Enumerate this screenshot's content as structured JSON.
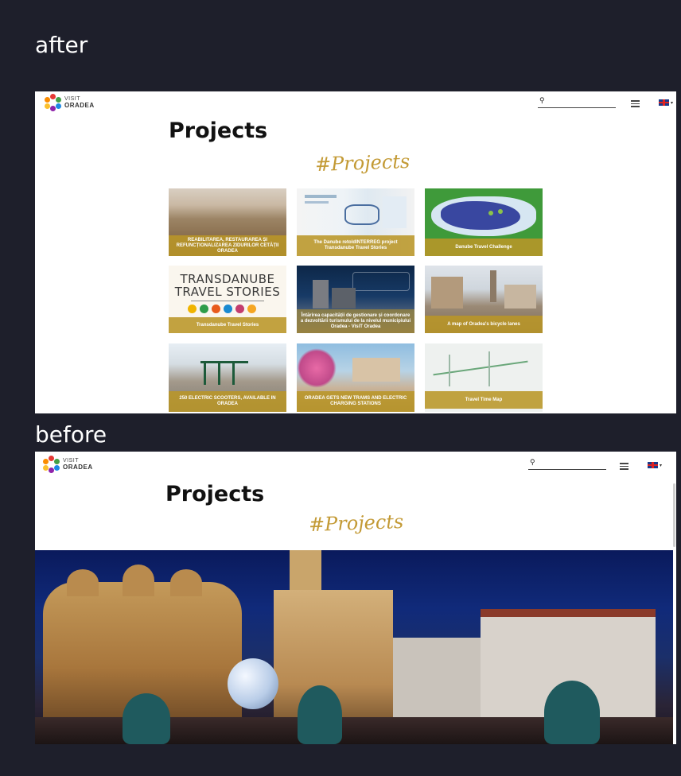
{
  "captions": {
    "after": "after",
    "before": "before"
  },
  "site": {
    "logo_line1": "VISIT",
    "logo_line2": "ORADEA",
    "search_icon": "search-icon",
    "menu_icon": "hamburger-menu-icon",
    "lang_icon": "uk-flag-icon",
    "lang_caret": "▾",
    "page_title": "Projects",
    "hashtag": "#Projects"
  },
  "cards": [
    {
      "label": "REABILITAREA, RESTAURAREA ȘI REFUNCȚIONALIZAREA ZIDURILOR CETĂȚII ORADEA"
    },
    {
      "label": "The Danube retoldINTERREG project Transdanube Travel Stories"
    },
    {
      "label": "Danube Travel Challenge"
    },
    {
      "label": "Transdanube Travel Stories",
      "image_text_line1": "TRANSDANUBE",
      "image_text_line2": "TRAVEL STORIES"
    },
    {
      "label": "Întărirea capacității de gestionare și coordonare a dezvoltării turismului de la nivelul municipiului Oradea - VisiT Oradea"
    },
    {
      "label": "A map of Oradea's bicycle lanes"
    },
    {
      "label": "250 ELECTRIC SCOOTERS, AVAILABLE IN ORADEA"
    },
    {
      "label": "ORADEA GETS NEW TRAMS AND ELECTRIC CHARGING STATIONS"
    },
    {
      "label": "Travel Time Map"
    }
  ],
  "colors": {
    "background": "#1e1f2b",
    "accent_gold": "#c39a35"
  }
}
